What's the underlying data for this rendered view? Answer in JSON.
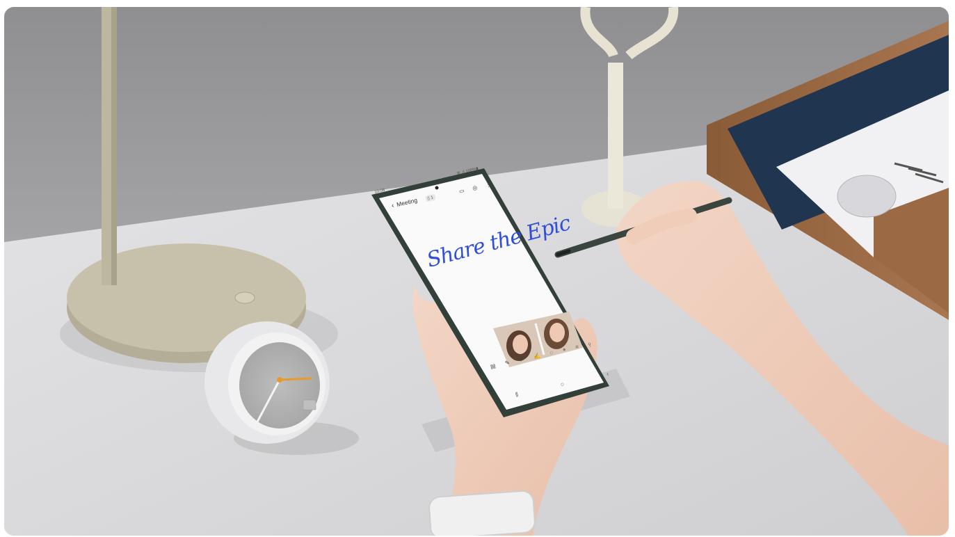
{
  "phone_screen": {
    "status_time": "10:08",
    "status_icons": "⊛ .ıl 100%▮",
    "back_glyph": "‹",
    "note_title": "Meeting",
    "page_badge": "▯ 1",
    "header_icons": "▭ ◎ ⋮",
    "handwriting": "Share the Epic",
    "toolbar_icons": "▤ ✎ ✐ ✍ ◌ ⌖ ⌗ ⚲",
    "nav_icons": "⦀ ○ ‹"
  },
  "colors": {
    "ink_blue": "#2f4fd8",
    "wall": "#9a9a9c",
    "desk": "#dcdcde",
    "phone_frame": "#33403a",
    "spen": "#3a4540"
  }
}
